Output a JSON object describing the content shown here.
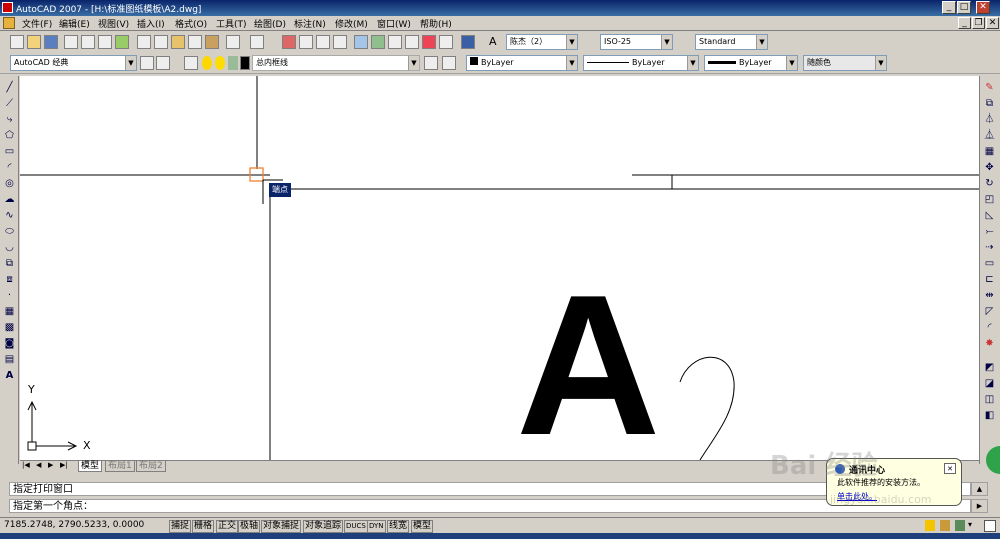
{
  "window": {
    "title": "AutoCAD 2007 - [H:\\标准图纸模板\\A2.dwg]",
    "min": "_",
    "max": "□",
    "close": "✕",
    "doc_min": "_",
    "doc_restore": "❐",
    "doc_close": "✕"
  },
  "menu": [
    "文件(F)",
    "编辑(E)",
    "视图(V)",
    "插入(I)",
    "格式(O)",
    "工具(T)",
    "绘图(D)",
    "标注(N)",
    "修改(M)",
    "窗口(W)",
    "帮助(H)"
  ],
  "toolbar1": {
    "text_style": "陈杰（2）",
    "dim_style": "ISO-25",
    "table_style": "Standard"
  },
  "toolbar2": {
    "workspace": "AutoCAD 经典",
    "layer": "总内框线",
    "color": "ByLayer",
    "linetype": "ByLayer",
    "lineweight": "ByLayer",
    "plotstyle": "随颜色"
  },
  "canvas": {
    "osnap_tooltip": "端点",
    "big_text": "A",
    "ucs_y": "Y",
    "ucs_x": "X"
  },
  "tabs": {
    "nav": [
      "|◀",
      "◀",
      "▶",
      "▶|"
    ],
    "items": [
      "模型",
      "布局1",
      "布局2"
    ]
  },
  "command": {
    "line1": "指定打印窗口",
    "line2": "指定第一个角点："
  },
  "status": {
    "coords": "7185.2748, 2790.5233, 0.0000",
    "buttons": [
      "捕捉",
      "栅格",
      "正交",
      "极轴",
      "对象捕捉",
      "对象追踪",
      "DUCS",
      "DYN",
      "线宽",
      "模型"
    ]
  },
  "notification": {
    "title": "通讯中心",
    "body": "此软件推荐的安装方法。",
    "link": "单击此处。",
    "close": "✕"
  },
  "watermark": {
    "brand": "Bai 经验",
    "url": "jingyan.baidu.com"
  },
  "colors": {
    "titlebar": "#0a246a",
    "canvas": "#ffffff",
    "face": "#d4d0c8",
    "osnap_marker": "#f08030",
    "tooltip_bg": "#0a246a"
  }
}
